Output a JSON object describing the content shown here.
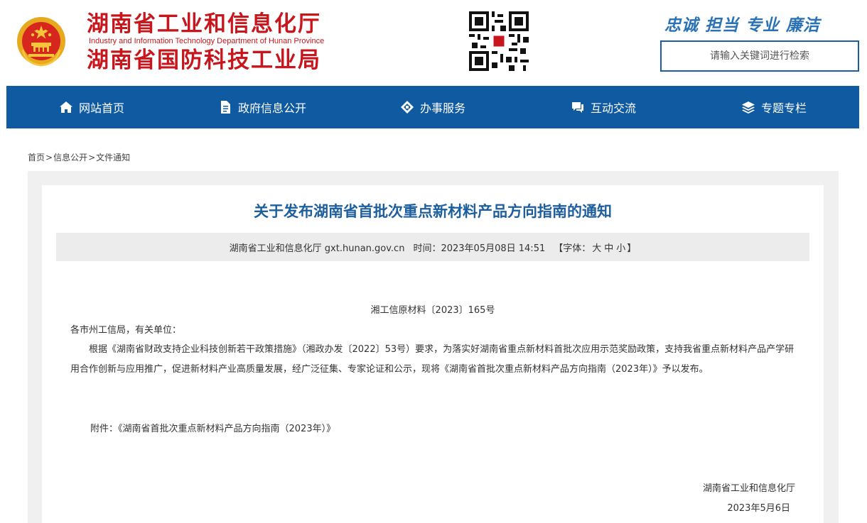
{
  "header": {
    "title_line1": "湖南省工业和信息化厅",
    "title_en": "Industry and Information Technology Department of Hunan Province",
    "title_line2": "湖南省国防科技工业局",
    "slogan": "忠诚  担当  专业  廉洁",
    "search_placeholder": "请输入关键词进行检索",
    "brand_color": "#c8161d",
    "accent_color": "#0f5aa0"
  },
  "nav": {
    "items": [
      {
        "label": "网站首页",
        "icon": "home-icon"
      },
      {
        "label": "政府信息公开",
        "icon": "document-icon"
      },
      {
        "label": "办事服务",
        "icon": "handshake-icon"
      },
      {
        "label": "互动交流",
        "icon": "chat-icon"
      },
      {
        "label": "专题专栏",
        "icon": "layers-icon"
      }
    ]
  },
  "breadcrumb": {
    "items": [
      "首页",
      "信息公开",
      "文件通知"
    ],
    "separator": ">"
  },
  "article": {
    "title": "关于发布湖南省首批次重点新材料产品方向指南的通知",
    "source": "湖南省工业和信息化厅 gxt.hunan.gov.cn",
    "time_label": "时间：",
    "time": "2023年05月08日 14:51",
    "font_label": "【字体：",
    "font_large": "大",
    "font_medium": "中",
    "font_small": "小",
    "font_close": "】",
    "doc_number": "湘工信原材料〔2023〕165号",
    "salutation": "各市州工信局，有关单位：",
    "paragraph": "根据《湖南省财政支持企业科技创新若干政策措施》（湘政办发〔2022〕53号）要求，为落实好湖南省重点新材料首批次应用示范奖励政策，支持我省重点新材料产品产学研用合作创新与应用推广，促进新材料产业高质量发展，经广泛征集、专家论证和公示，现将《湖南省首批次重点新材料产品方向指南（2023年）》予以发布。",
    "attachment": "附件：《湖南省首批次重点新材料产品方向指南（2023年）》",
    "signature": "湖南省工业和信息化厅",
    "date": "2023年5月6日"
  }
}
